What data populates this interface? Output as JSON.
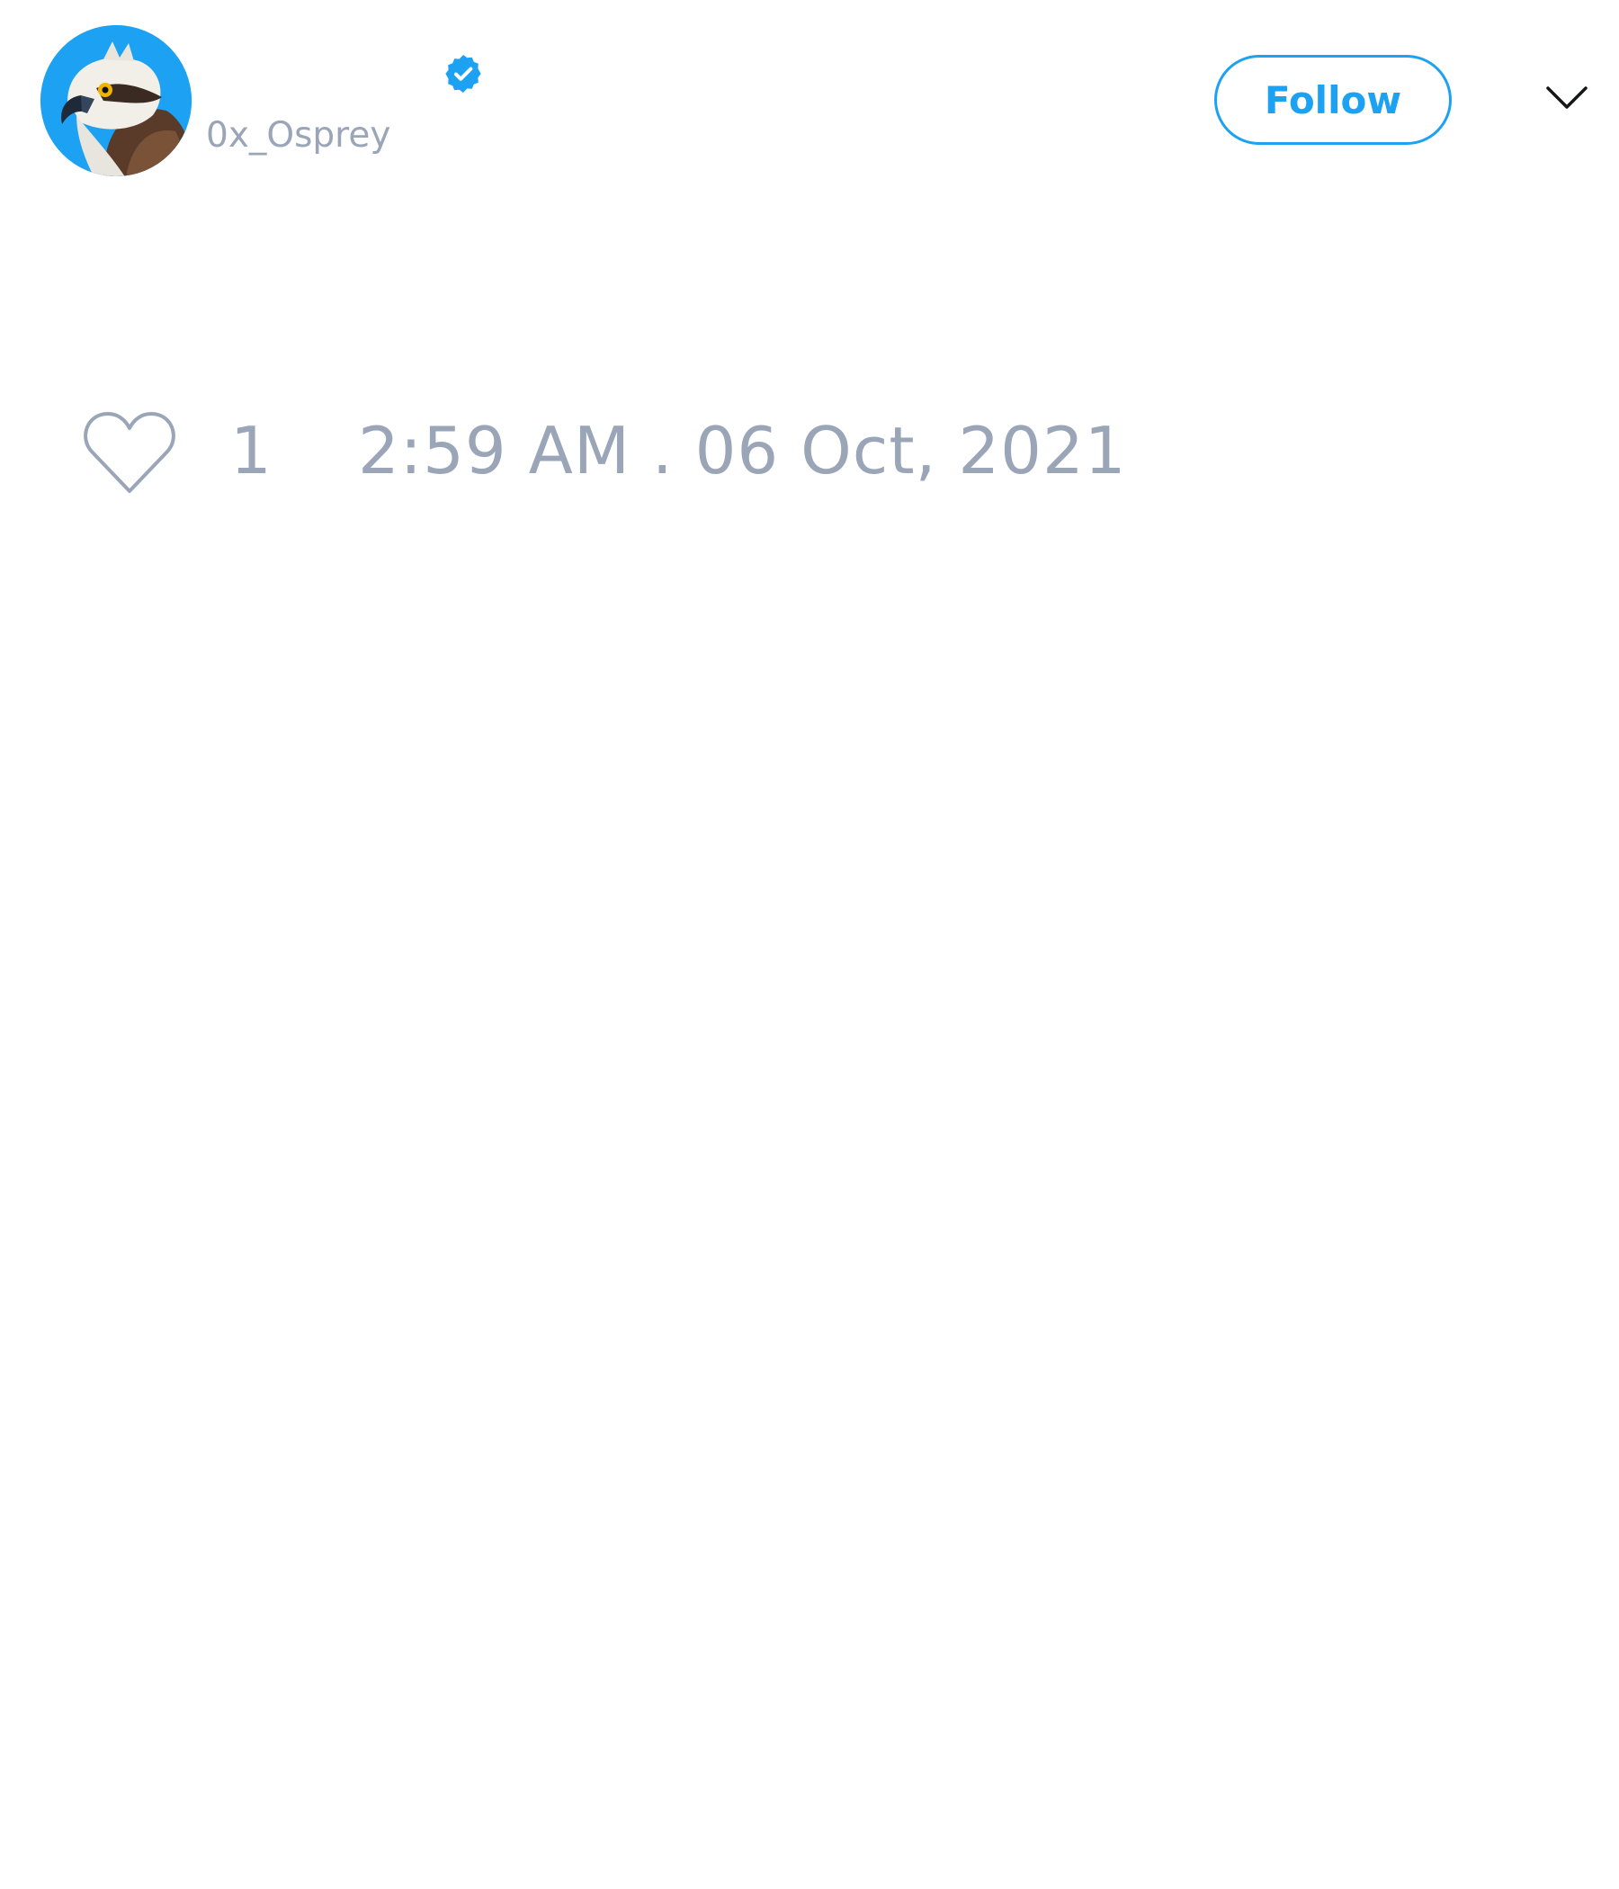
{
  "tweet": {
    "author": {
      "display_name": "",
      "handle": "0x_Osprey",
      "verified": true,
      "avatar_icon": "osprey-avatar"
    },
    "follow_label": "Follow",
    "menu_icon": "chevron-down-icon",
    "like_icon": "heart-icon",
    "like_count": "1",
    "timestamp": "2:59 AM . 06 Oct, 2021"
  },
  "colors": {
    "accent": "#1da1f2",
    "muted_text": "#9aa6b8",
    "background": "#ffffff"
  }
}
